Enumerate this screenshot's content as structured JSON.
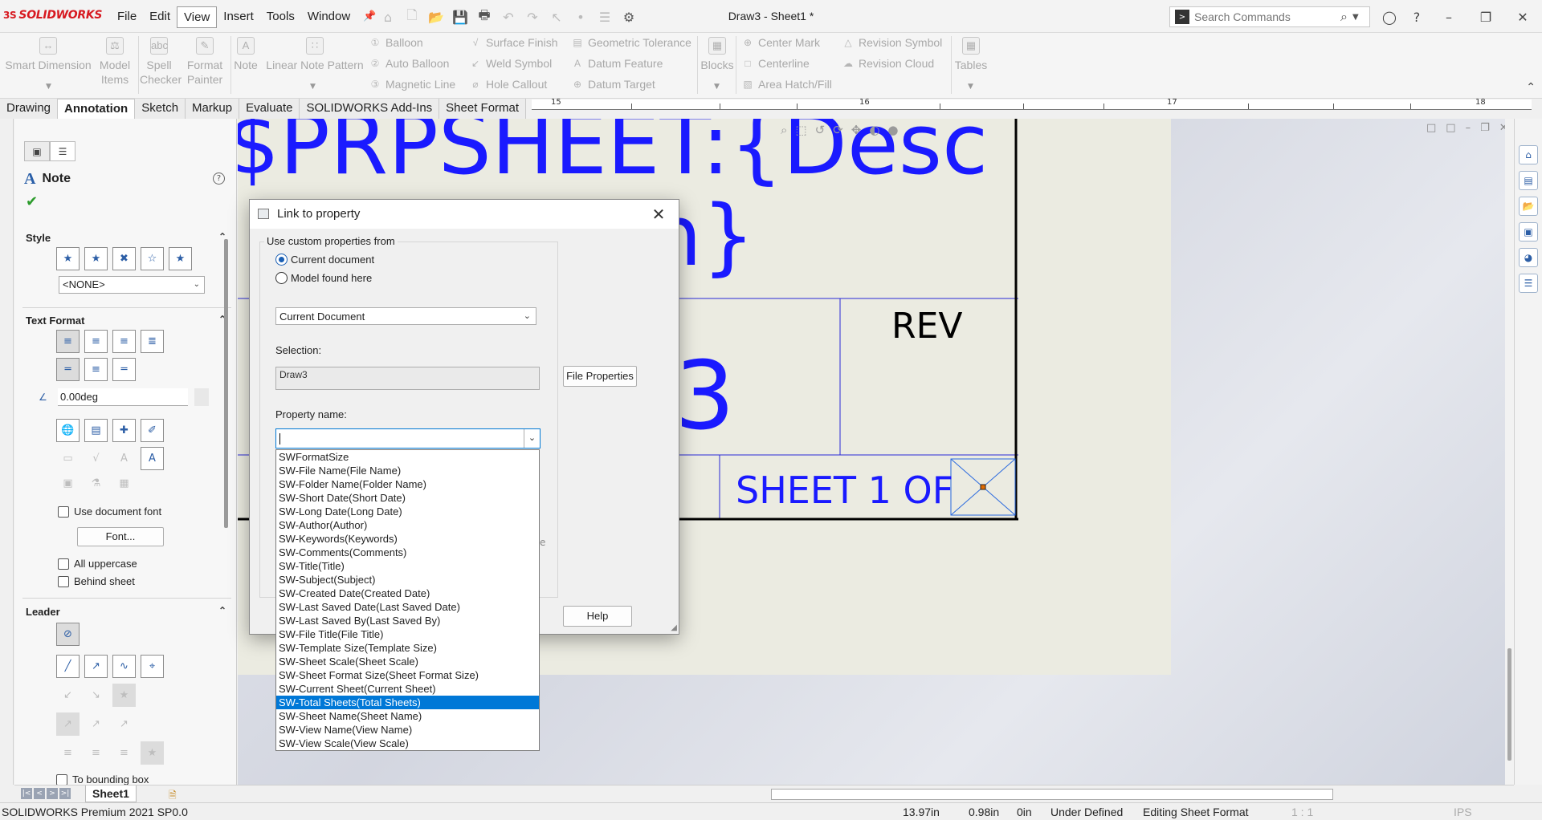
{
  "app": {
    "logo_prefix": "3S",
    "logo_text": "SOLIDWORKS",
    "document_title": "Draw3 - Sheet1 *"
  },
  "menu": {
    "items": [
      "File",
      "Edit",
      "View",
      "Insert",
      "Tools",
      "Window"
    ],
    "active": "View"
  },
  "search": {
    "placeholder": "Search Commands"
  },
  "ribbon": {
    "smart_dimension": "Smart Dimension",
    "model_items": "Model Items",
    "spell_checker": "Spell Checker",
    "format_painter": "Format Painter",
    "note": "Note",
    "linear_note_pattern": "Linear Note Pattern",
    "balloon": "Balloon",
    "auto_balloon": "Auto Balloon",
    "magnetic_line": "Magnetic Line",
    "surface_finish": "Surface Finish",
    "weld_symbol": "Weld Symbol",
    "hole_callout": "Hole Callout",
    "geometric_tolerance": "Geometric Tolerance",
    "datum_feature": "Datum Feature",
    "datum_target": "Datum Target",
    "blocks": "Blocks",
    "center_mark": "Center Mark",
    "centerline": "Centerline",
    "area_hatch_fill": "Area Hatch/Fill",
    "revision_symbol": "Revision Symbol",
    "revision_cloud": "Revision Cloud",
    "tables": "Tables"
  },
  "tabs": [
    "Drawing",
    "Annotation",
    "Sketch",
    "Markup",
    "Evaluate",
    "SOLIDWORKS Add-Ins",
    "Sheet Format"
  ],
  "active_tab": "Annotation",
  "ruler": {
    "labels": [
      "15",
      "16",
      "17",
      "18"
    ]
  },
  "property_manager": {
    "title": "Note",
    "style_title": "Style",
    "style_value": "<NONE>",
    "text_format_title": "Text Format",
    "angle_value": "0.00deg",
    "use_document_font": "Use document font",
    "font_button": "Font...",
    "all_uppercase": "All uppercase",
    "behind_sheet": "Behind sheet",
    "leader_title": "Leader",
    "to_bounding_box": "To bounding box"
  },
  "drawing": {
    "line1": "$PRPSHEET:{Desc",
    "line2": "n}",
    "rev_label": "REV",
    "big_digit": "3",
    "sheet_of": "SHEET 1 OF"
  },
  "dialog": {
    "title": "Link to property",
    "group_label": "Use custom properties from",
    "radio_current": "Current document",
    "radio_model": "Model found here",
    "source_select": "Current Document",
    "selection_label": "Selection:",
    "selection_value": "Draw3",
    "file_properties_button": "File Properties",
    "property_name_label": "Property name:",
    "property_name_value": "",
    "help_button": "Help"
  },
  "dropdown": {
    "items": [
      "SWFormatSize",
      "SW-File Name(File Name)",
      "SW-Folder Name(Folder Name)",
      "SW-Short Date(Short Date)",
      "SW-Long Date(Long Date)",
      "SW-Author(Author)",
      "SW-Keywords(Keywords)",
      "SW-Comments(Comments)",
      "SW-Title(Title)",
      "SW-Subject(Subject)",
      "SW-Created Date(Created Date)",
      "SW-Last Saved Date(Last Saved Date)",
      "SW-Last Saved By(Last Saved By)",
      "SW-File Title(File Title)",
      "SW-Template Size(Template Size)",
      "SW-Sheet Scale(Sheet Scale)",
      "SW-Sheet Format Size(Sheet Format Size)",
      "SW-Current Sheet(Current Sheet)",
      "SW-Total Sheets(Total Sheets)",
      "SW-Sheet Name(Sheet Name)",
      "SW-View Name(View Name)",
      "SW-View Scale(View Scale)"
    ],
    "selected_index": 18
  },
  "sheet_tabs": {
    "sheet1": "Sheet1"
  },
  "status": {
    "product": "SOLIDWORKS Premium 2021 SP0.0",
    "x": "13.97in",
    "y": "0.98in",
    "z": "0in",
    "state": "Under Defined",
    "mode": "Editing Sheet Format",
    "scale": "1 : 1",
    "units": "IPS"
  },
  "colors": {
    "brand_red": "#d71920",
    "annotation_blue": "#1a1aff",
    "selection_blue": "#0078d7"
  }
}
